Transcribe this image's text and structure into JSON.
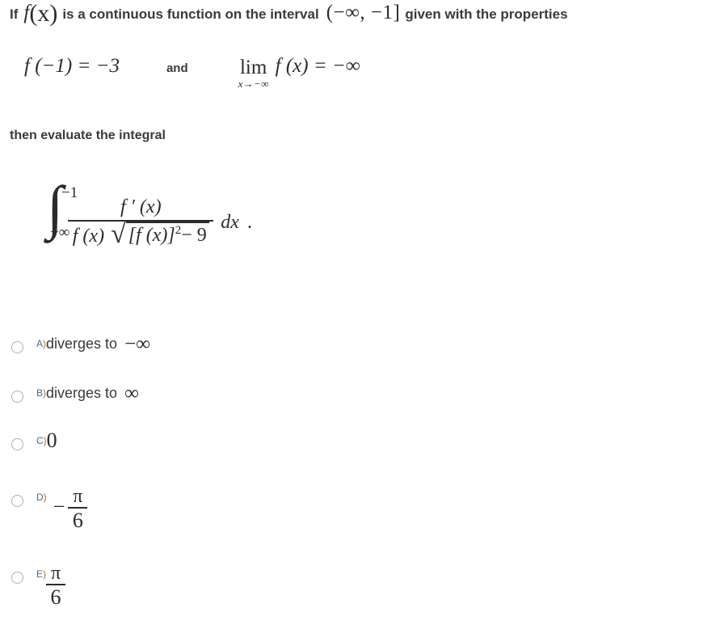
{
  "question": {
    "statement": {
      "part1": "If",
      "func": "f",
      "arg": "(x)",
      "part2": "is a continuous function on the interval",
      "interval": "(−∞, −1]",
      "part3": "given with the properties"
    },
    "properties": {
      "value_condition": "f (−1) = −3",
      "connector": "and",
      "limit_operator": "lim",
      "limit_subscript": "x→−∞",
      "limit_body": "f (x) = −∞"
    },
    "instruction": "then evaluate the integral",
    "integral": {
      "upper_limit": "−1",
      "lower_limit": "−∞",
      "numerator": "f ′ (x)",
      "denominator_factor": "f (x)",
      "radicand_base": "[f (x)]",
      "radicand_exponent": "2",
      "radicand_rest": "− 9",
      "differential": "dx",
      "terminator": "."
    }
  },
  "options": [
    {
      "letter": "A",
      "paren": ")",
      "text": "diverges to",
      "math": "−∞",
      "kind": "text-math"
    },
    {
      "letter": "B",
      "paren": ")",
      "text": "diverges to",
      "math": "∞",
      "kind": "text-math"
    },
    {
      "letter": "C",
      "paren": ")",
      "text": "",
      "math": "0",
      "kind": "zero"
    },
    {
      "letter": "D",
      "paren": ")",
      "text": "",
      "sign": "−",
      "numerator": "π",
      "denominator": "6",
      "kind": "fraction"
    },
    {
      "letter": "E",
      "paren": ")",
      "text": "",
      "sign": "",
      "numerator": "π",
      "denominator": "6",
      "kind": "fraction"
    }
  ],
  "colors": {
    "text": "#3a3a3a",
    "math": "#2b2b2b",
    "option_letter": "#4a6b8a",
    "option_paren": "#b06a2c",
    "radio_border": "#b0b0b0",
    "background": "#ffffff"
  }
}
